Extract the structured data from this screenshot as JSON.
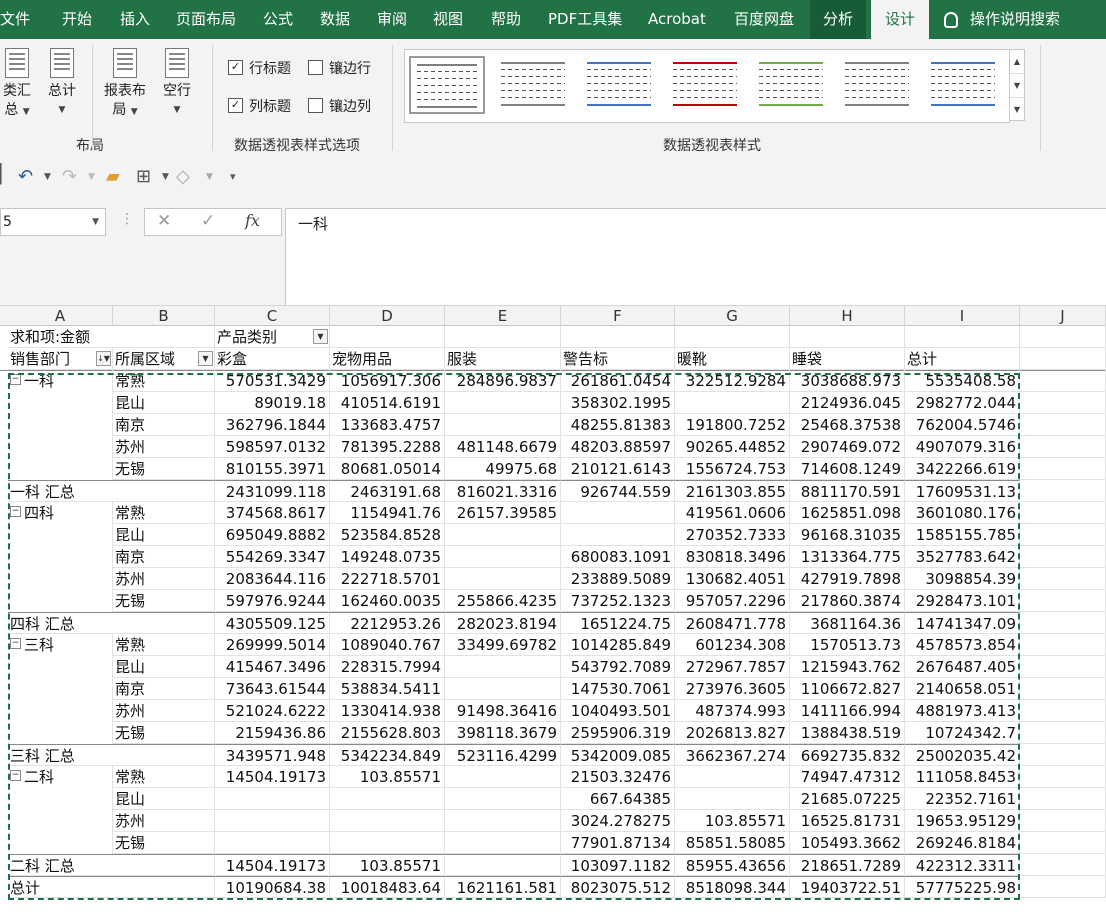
{
  "tabs": [
    "文件",
    "开始",
    "插入",
    "页面布局",
    "公式",
    "数据",
    "审阅",
    "视图",
    "帮助",
    "PDF工具集",
    "Acrobat",
    "百度网盘",
    "分析",
    "设计"
  ],
  "tell_me": "操作说明搜索",
  "ribbon": {
    "buttons": [
      {
        "line1": "类汇",
        "line2": "总"
      },
      {
        "line1": "总计",
        "line2": ""
      },
      {
        "line1": "报表布",
        "line2": "局"
      },
      {
        "line1": "空行",
        "line2": ""
      }
    ],
    "layout_group": "布局",
    "checkbox_row_headers": "行标题",
    "checkbox_banded_rows": "镶边行",
    "checkbox_col_headers": "列标题",
    "checkbox_banded_cols": "镶边列",
    "options_group": "数据透视表样式选项",
    "styles_group": "数据透视表样式",
    "style_colors": [
      "#7f7f7f",
      "#7f7f7f",
      "#4472c4",
      "#c00000",
      "#70ad47",
      "#7f7f7f",
      "#4472c4"
    ]
  },
  "namebox": "5",
  "formula": "一科",
  "columns": [
    "A",
    "B",
    "C",
    "D",
    "E",
    "F",
    "G",
    "H",
    "I",
    "J"
  ],
  "pivot": {
    "title": "求和项:金额",
    "col_field": "产品类别",
    "row_field1": "销售部门",
    "row_field2": "所属区域",
    "headers": [
      "彩盒",
      "宠物用品",
      "服装",
      "警告标",
      "暖靴",
      "睡袋",
      "总计"
    ]
  },
  "rows": [
    {
      "a": "一科",
      "b": "常熟",
      "v": [
        "570531.3429",
        "1056917.306",
        "284896.9837",
        "261861.0454",
        "322512.9284",
        "3038688.973",
        "5535408.58"
      ],
      "group": true
    },
    {
      "a": "",
      "b": "昆山",
      "v": [
        "89019.18",
        "410514.6191",
        "",
        "358302.1995",
        "",
        "2124936.045",
        "2982772.044"
      ]
    },
    {
      "a": "",
      "b": "南京",
      "v": [
        "362796.1844",
        "133683.4757",
        "",
        "48255.81383",
        "191800.7252",
        "25468.37538",
        "762004.5746"
      ]
    },
    {
      "a": "",
      "b": "苏州",
      "v": [
        "598597.0132",
        "781395.2288",
        "481148.6679",
        "48203.88597",
        "90265.44852",
        "2907469.072",
        "4907079.316"
      ]
    },
    {
      "a": "",
      "b": "无锡",
      "v": [
        "810155.3971",
        "80681.05014",
        "49975.68",
        "210121.6143",
        "1556724.753",
        "714608.1249",
        "3422266.619"
      ]
    },
    {
      "a": "一科 汇总",
      "b": "",
      "v": [
        "2431099.118",
        "2463191.68",
        "816021.3316",
        "926744.559",
        "2161303.855",
        "8811170.591",
        "17609531.13"
      ],
      "subtotal": true
    },
    {
      "a": "四科",
      "b": "常熟",
      "v": [
        "374568.8617",
        "1154941.76",
        "26157.39585",
        "",
        "419561.0606",
        "1625851.098",
        "3601080.176"
      ],
      "group": true
    },
    {
      "a": "",
      "b": "昆山",
      "v": [
        "695049.8882",
        "523584.8528",
        "",
        "",
        "270352.7333",
        "96168.31035",
        "1585155.785"
      ]
    },
    {
      "a": "",
      "b": "南京",
      "v": [
        "554269.3347",
        "149248.0735",
        "",
        "680083.1091",
        "830818.3496",
        "1313364.775",
        "3527783.642"
      ]
    },
    {
      "a": "",
      "b": "苏州",
      "v": [
        "2083644.116",
        "222718.5701",
        "",
        "233889.5089",
        "130682.4051",
        "427919.7898",
        "3098854.39"
      ]
    },
    {
      "a": "",
      "b": "无锡",
      "v": [
        "597976.9244",
        "162460.0035",
        "255866.4235",
        "737252.1323",
        "957057.2296",
        "217860.3874",
        "2928473.101"
      ]
    },
    {
      "a": "四科 汇总",
      "b": "",
      "v": [
        "4305509.125",
        "2212953.26",
        "282023.8194",
        "1651224.75",
        "2608471.778",
        "3681164.36",
        "14741347.09"
      ],
      "subtotal": true
    },
    {
      "a": "三科",
      "b": "常熟",
      "v": [
        "269999.5014",
        "1089040.767",
        "33499.69782",
        "1014285.849",
        "601234.308",
        "1570513.73",
        "4578573.854"
      ],
      "group": true
    },
    {
      "a": "",
      "b": "昆山",
      "v": [
        "415467.3496",
        "228315.7994",
        "",
        "543792.7089",
        "272967.7857",
        "1215943.762",
        "2676487.405"
      ]
    },
    {
      "a": "",
      "b": "南京",
      "v": [
        "73643.61544",
        "538834.5411",
        "",
        "147530.7061",
        "273976.3605",
        "1106672.827",
        "2140658.051"
      ]
    },
    {
      "a": "",
      "b": "苏州",
      "v": [
        "521024.6222",
        "1330414.938",
        "91498.36416",
        "1040493.501",
        "487374.993",
        "1411166.994",
        "4881973.413"
      ]
    },
    {
      "a": "",
      "b": "无锡",
      "v": [
        "2159436.86",
        "2155628.803",
        "398118.3679",
        "2595906.319",
        "2026813.827",
        "1388438.519",
        "10724342.7"
      ]
    },
    {
      "a": "三科 汇总",
      "b": "",
      "v": [
        "3439571.948",
        "5342234.849",
        "523116.4299",
        "5342009.085",
        "3662367.274",
        "6692735.832",
        "25002035.42"
      ],
      "subtotal": true
    },
    {
      "a": "二科",
      "b": "常熟",
      "v": [
        "14504.19173",
        "103.85571",
        "",
        "21503.32476",
        "",
        "74947.47312",
        "111058.8453"
      ],
      "group": true
    },
    {
      "a": "",
      "b": "昆山",
      "v": [
        "",
        "",
        "",
        "667.64385",
        "",
        "21685.07225",
        "22352.7161"
      ]
    },
    {
      "a": "",
      "b": "苏州",
      "v": [
        "",
        "",
        "",
        "3024.278275",
        "103.85571",
        "16525.81731",
        "19653.95129"
      ]
    },
    {
      "a": "",
      "b": "无锡",
      "v": [
        "",
        "",
        "",
        "77901.87134",
        "85851.58085",
        "105493.3662",
        "269246.8184"
      ]
    },
    {
      "a": "二科 汇总",
      "b": "",
      "v": [
        "14504.19173",
        "103.85571",
        "",
        "103097.1182",
        "85955.43656",
        "218651.7289",
        "422312.3311"
      ],
      "subtotal": true
    },
    {
      "a": "总计",
      "b": "",
      "v": [
        "10190684.38",
        "10018483.64",
        "1621161.581",
        "8023075.512",
        "8518098.344",
        "19403722.51",
        "57775225.98"
      ],
      "subtotal": true
    }
  ]
}
